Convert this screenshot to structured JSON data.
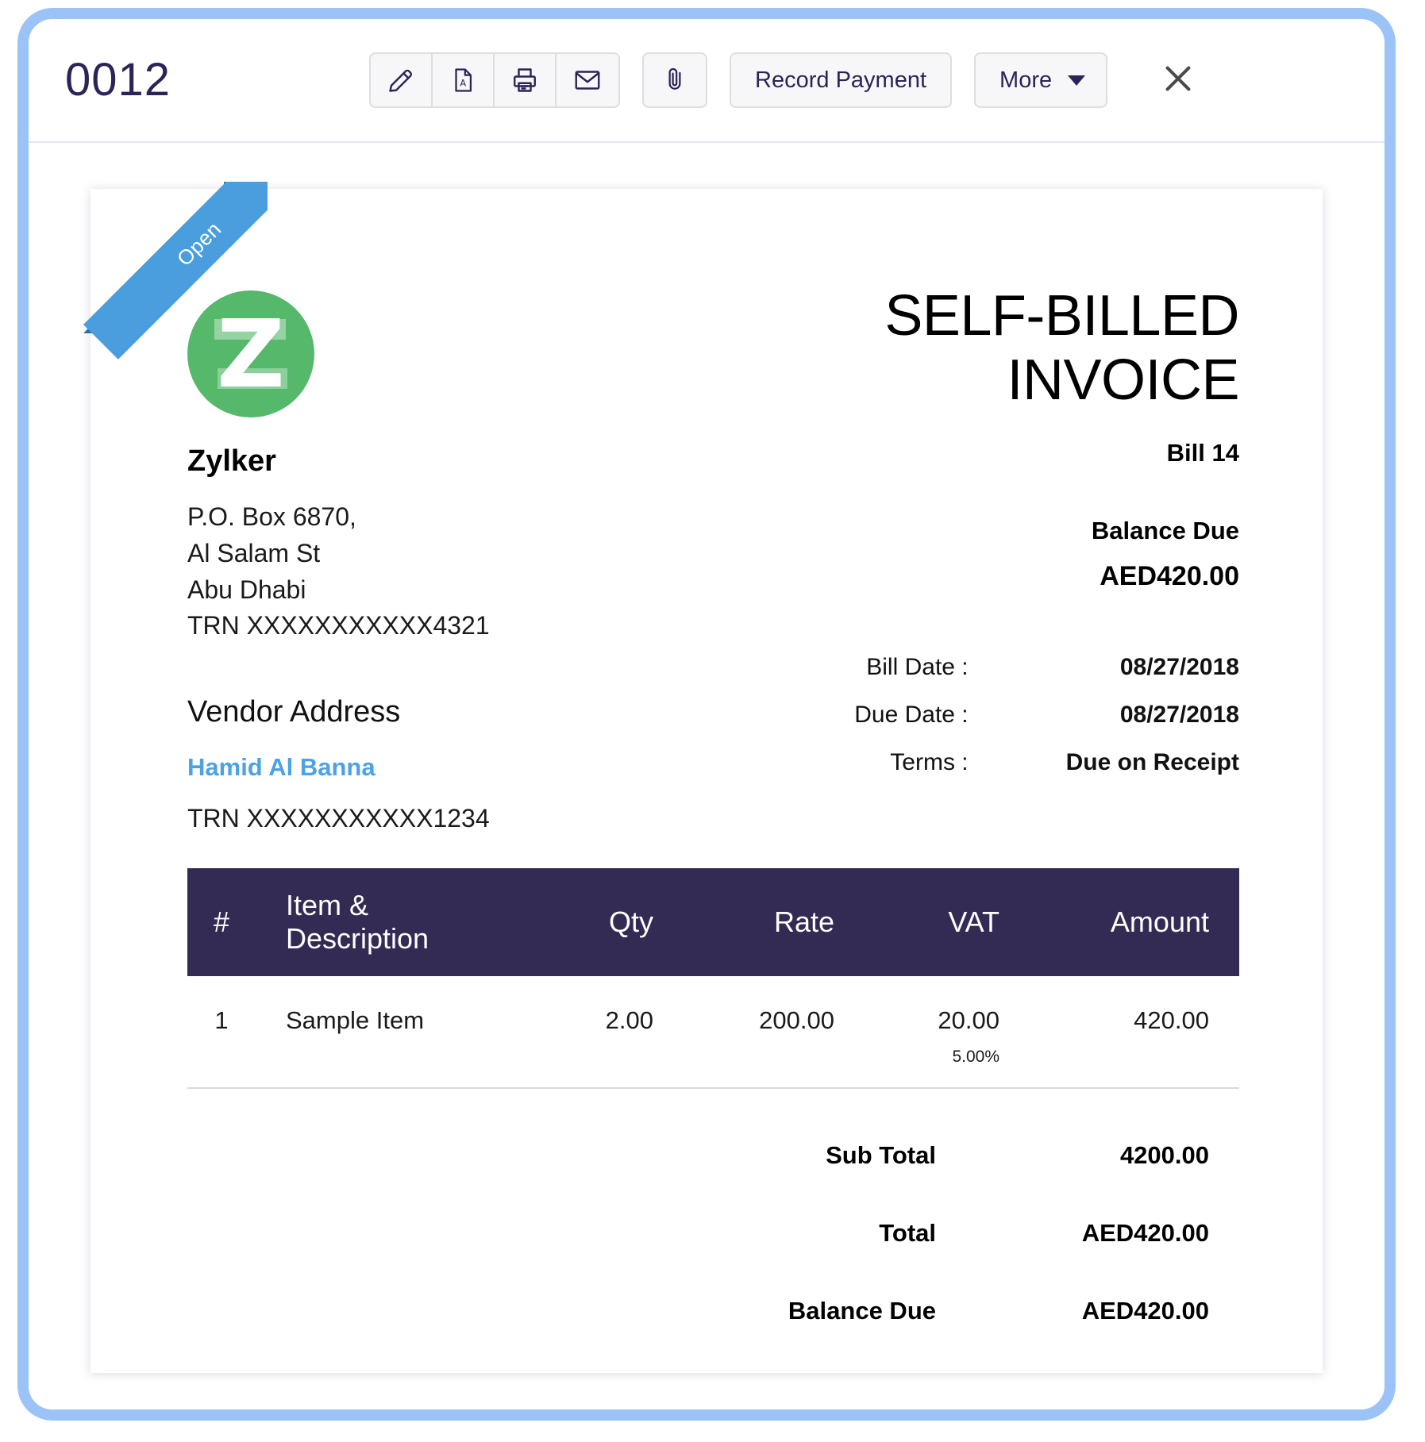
{
  "header": {
    "record_number": "0012",
    "icon_buttons": [
      {
        "name": "edit-icon",
        "label": "Edit"
      },
      {
        "name": "pdf-icon",
        "label": "PDF"
      },
      {
        "name": "print-icon",
        "label": "Print"
      },
      {
        "name": "email-icon",
        "label": "Email"
      }
    ],
    "attachment_button": {
      "name": "attachment-icon",
      "label": "Attachment"
    },
    "record_payment_label": "Record Payment",
    "more_label": "More",
    "close_label": "Close"
  },
  "document": {
    "status_ribbon": "Open",
    "logo_letter": "Z",
    "organization": {
      "name": "Zylker",
      "address_lines": [
        "P.O. Box 6870,",
        "Al Salam St",
        "Abu Dhabi"
      ],
      "trn": "TRN XXXXXXXXXXX4321"
    },
    "vendor": {
      "heading": "Vendor Address",
      "name": "Hamid Al Banna",
      "trn": "TRN XXXXXXXXXXX1234"
    },
    "title": "SELF-BILLED INVOICE",
    "bill_number": "Bill 14",
    "balance_due_label": "Balance Due",
    "balance_due_value": "AED420.00",
    "meta": [
      {
        "label": "Bill Date :",
        "value": "08/27/2018"
      },
      {
        "label": "Due Date :",
        "value": "08/27/2018"
      },
      {
        "label": "Terms :",
        "value": "Due on Receipt"
      }
    ],
    "table": {
      "columns": [
        "#",
        "Item & Description",
        "Qty",
        "Rate",
        "VAT",
        "Amount"
      ],
      "rows": [
        {
          "num": "1",
          "description": "Sample Item",
          "qty": "2.00",
          "rate": "200.00",
          "vat": "20.00",
          "vat_pct": "5.00%",
          "amount": "420.00"
        }
      ]
    },
    "totals": [
      {
        "label": "Sub Total",
        "value": "4200.00"
      },
      {
        "label": "Total",
        "value": "AED420.00"
      },
      {
        "label": "Balance Due",
        "value": "AED420.00"
      }
    ]
  },
  "colors": {
    "frame_blue": "#9cc3f7",
    "ribbon_blue": "#4a9edd",
    "table_header": "#332b53",
    "logo_green": "#55b86b",
    "link_blue": "#4ba2e5",
    "title_navy": "#2b2456"
  }
}
